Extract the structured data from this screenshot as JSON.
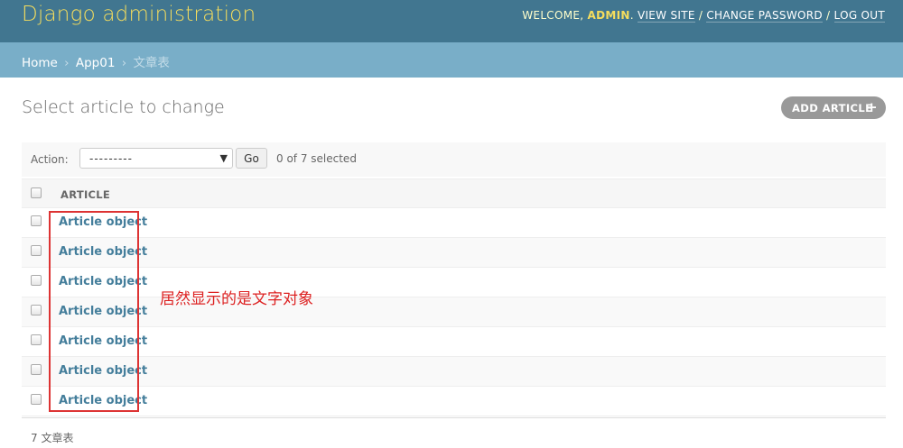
{
  "header": {
    "branding": "Django administration",
    "welcome": "WELCOME,",
    "username": "ADMIN",
    "period": ".",
    "view_site": "VIEW SITE",
    "change_password": "CHANGE PASSWORD",
    "log_out": "LOG OUT",
    "separator": "/"
  },
  "breadcrumbs": {
    "home": "Home",
    "app": "App01",
    "current": "文章表",
    "separator": "›"
  },
  "content": {
    "title": "Select article to change",
    "add_button": "ADD ARTICLE",
    "add_icon": "+"
  },
  "actions": {
    "label": "Action:",
    "select_value": "---------",
    "caret": "▼",
    "go": "Go",
    "selection": "0 of 7 selected"
  },
  "table": {
    "column": "ARTICLE",
    "rows": [
      "Article object",
      "Article object",
      "Article object",
      "Article object",
      "Article object",
      "Article object",
      "Article object"
    ]
  },
  "annotation": "居然显示的是文字对象",
  "paginator": "7 文章表",
  "colors": {
    "header_bg": "#417690",
    "branding": "#f5dd5d",
    "breadcrumb_bg": "#79aec8",
    "link": "#447e9b",
    "annotation": "#dd2222"
  }
}
